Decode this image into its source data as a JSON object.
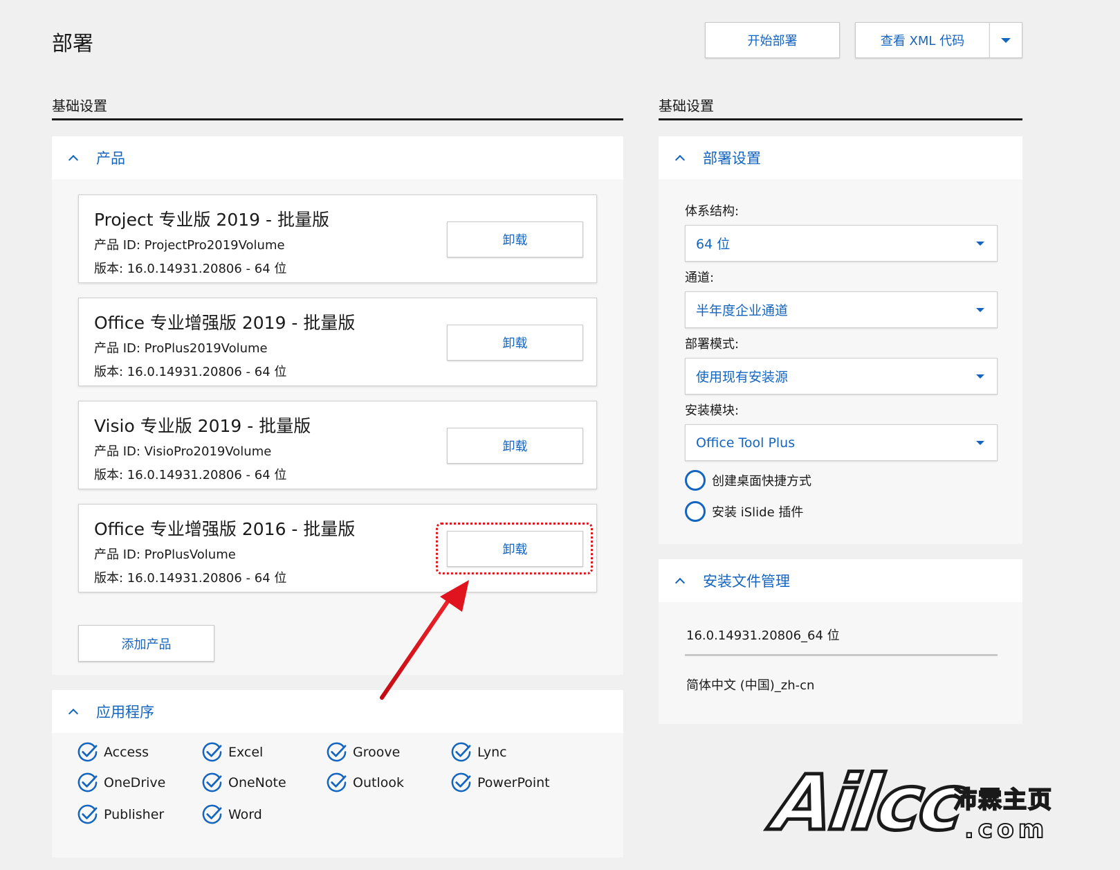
{
  "header": {
    "title": "部署",
    "deploy_button": "开始部署",
    "xml_button": "查看 XML 代码"
  },
  "left": {
    "section_title": "基础设置",
    "products_panel": {
      "title": "产品",
      "items": [
        {
          "name": "Project 专业版 2019 - 批量版",
          "id": "产品 ID: ProjectPro2019Volume",
          "version": "版本: 16.0.14931.20806 - 64 位",
          "button": "卸载"
        },
        {
          "name": "Office 专业增强版 2019 - 批量版",
          "id": "产品 ID: ProPlus2019Volume",
          "version": "版本: 16.0.14931.20806 - 64 位",
          "button": "卸载"
        },
        {
          "name": "Visio 专业版 2019 - 批量版",
          "id": "产品 ID: VisioPro2019Volume",
          "version": "版本: 16.0.14931.20806 - 64 位",
          "button": "卸载"
        },
        {
          "name": "Office 专业增强版 2016 - 批量版",
          "id": "产品 ID: ProPlusVolume",
          "version": "版本: 16.0.14931.20806 - 64 位",
          "button": "卸载"
        }
      ],
      "add_button": "添加产品"
    },
    "apps_panel": {
      "title": "应用程序",
      "apps": [
        "Access",
        "Excel",
        "Groove",
        "Lync",
        "OneDrive",
        "OneNote",
        "Outlook",
        "PowerPoint",
        "Publisher",
        "Word"
      ]
    }
  },
  "right": {
    "section_title": "基础设置",
    "deploy_panel": {
      "title": "部署设置",
      "architecture_label": "体系结构:",
      "architecture_value": "64 位",
      "channel_label": "通道:",
      "channel_value": "半年度企业通道",
      "mode_label": "部署模式:",
      "mode_value": "使用现有安装源",
      "module_label": "安装模块:",
      "module_value": "Office Tool Plus",
      "option_shortcut": "创建桌面快捷方式",
      "option_islide": "安装 iSlide 插件"
    },
    "files_panel": {
      "title": "安装文件管理",
      "version_entry": "16.0.14931.20806_64 位",
      "language_entry": "简体中文 (中国)_zh-cn"
    }
  },
  "watermark": {
    "main": "Ailcc",
    "sub": "沛霖主页",
    "domain": ".com"
  },
  "colors": {
    "accent": "#1465c0",
    "background": "#f0f0f0",
    "highlight": "#e0141e"
  },
  "icons": [
    "chevron-up-icon",
    "chevron-down-icon",
    "check-circle-icon",
    "radio-circle-icon",
    "arrow-annotation-icon"
  ]
}
